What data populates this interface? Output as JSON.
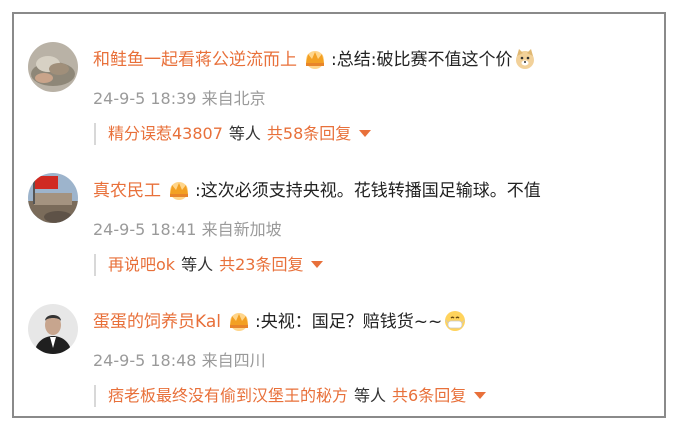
{
  "comments": [
    {
      "username": "和鲑鱼一起看蒋公逆流而上",
      "text": ":总结:破比赛不值这个价",
      "time": "24-9-5 18:39",
      "location": "来自北京",
      "replier": "精分误惹43807",
      "others": "等人",
      "reply_count": "共58条回复",
      "emoji": "doge-icon"
    },
    {
      "username": "真农民工",
      "text": ":这次必须支持央视。花钱转播国足输球。不值",
      "time": "24-9-5 18:41",
      "location": "来自新加坡",
      "replier": "再说吧ok",
      "others": "等人",
      "reply_count": "共23条回复"
    },
    {
      "username": "蛋蛋的饲养员Kal",
      "text": ":央视：国足？赔钱货~~",
      "time": "24-9-5 18:48",
      "location": "来自四川",
      "replier": "痞老板最终没有偷到汉堡王的秘方",
      "others": "等人",
      "reply_count": "共6条回复",
      "emoji": "mask-face-icon"
    }
  ],
  "colors": {
    "accent": "#e8703a",
    "meta": "#9a9a9a",
    "text": "#222222"
  }
}
